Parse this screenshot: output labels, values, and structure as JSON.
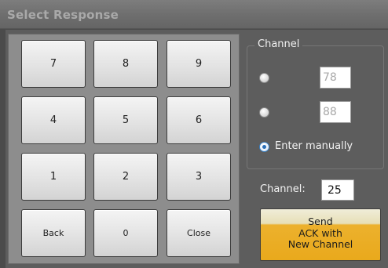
{
  "window": {
    "title": "Select Response"
  },
  "keypad": {
    "keys": [
      "7",
      "8",
      "9",
      "4",
      "5",
      "6",
      "1",
      "2",
      "3",
      "Back",
      "0",
      "Close"
    ]
  },
  "channel_group": {
    "label": "Channel",
    "options": [
      {
        "value": "78",
        "checked": false
      },
      {
        "value": "88",
        "checked": false
      },
      {
        "label": "Enter manually",
        "checked": true
      }
    ]
  },
  "channel_entry": {
    "label": "Channel:",
    "value": "25"
  },
  "send_button": {
    "line1": "Send",
    "line2": "ACK with",
    "line3": "New Channel"
  },
  "colors": {
    "send_accent": "#e9a91c",
    "radio_selected": "#2a6fb8"
  }
}
